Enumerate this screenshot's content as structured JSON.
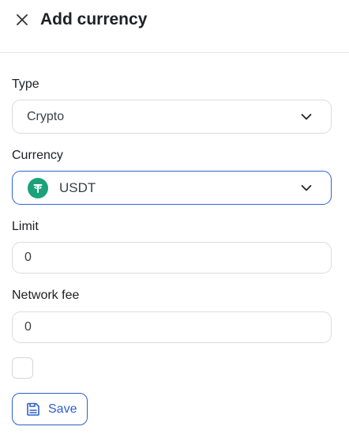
{
  "header": {
    "title": "Add currency",
    "close_icon": "close-icon"
  },
  "form": {
    "type": {
      "label": "Type",
      "value": "Crypto"
    },
    "currency": {
      "label": "Currency",
      "value": "USDT",
      "coin_symbol": "₮",
      "coin_color": "#1ba27a"
    },
    "limit": {
      "label": "Limit",
      "value": "0"
    },
    "network_fee": {
      "label": "Network fee",
      "value": "0"
    },
    "checkbox": {
      "checked": false
    }
  },
  "actions": {
    "save_label": "Save"
  },
  "colors": {
    "accent": "#2f5fca",
    "border": "#d9dce0",
    "coin": "#1ba27a"
  }
}
